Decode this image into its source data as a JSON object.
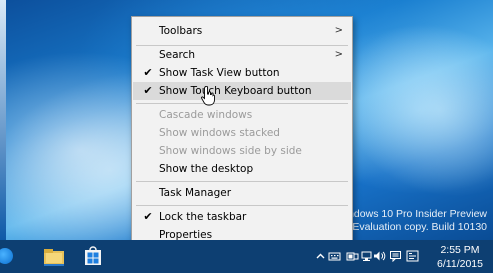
{
  "context_menu": {
    "items": [
      {
        "label": "Toolbars",
        "submenu": true,
        "checked": false,
        "disabled": false
      },
      {
        "label": "Search",
        "submenu": true,
        "checked": false,
        "disabled": false
      },
      {
        "label": "Show Task View button",
        "submenu": false,
        "checked": true,
        "disabled": false
      },
      {
        "label": "Show Touch Keyboard button",
        "submenu": false,
        "checked": true,
        "disabled": false,
        "hovered": true
      },
      {
        "label": "Cascade windows",
        "disabled": true
      },
      {
        "label": "Show windows stacked",
        "disabled": true
      },
      {
        "label": "Show windows side by side",
        "disabled": true
      },
      {
        "label": "Show the desktop",
        "disabled": false
      },
      {
        "label": "Task Manager",
        "disabled": false
      },
      {
        "label": "Lock the taskbar",
        "checked": true,
        "disabled": false
      },
      {
        "label": "Properties",
        "disabled": false
      }
    ],
    "submenu_glyph": ">",
    "check_glyph": "✔"
  },
  "watermark": {
    "line1": "Windows 10 Pro Insider Preview",
    "line2": "Evaluation copy. Build 10130"
  },
  "taskbar": {
    "pinned": [
      "start-icon",
      "file-explorer-icon",
      "store-icon"
    ],
    "tray_icons": [
      "chevron-up-icon",
      "touch-keyboard-icon",
      "battery-icon",
      "network-icon",
      "volume-icon",
      "action-center-icon",
      "language-icon"
    ],
    "time": "2:55 PM",
    "date": "6/11/2015"
  },
  "colors": {
    "taskbar": "#0d3f72",
    "menu_bg": "#f2f2f2",
    "menu_hover": "#dadada",
    "disabled_text": "#9b9b9b"
  }
}
